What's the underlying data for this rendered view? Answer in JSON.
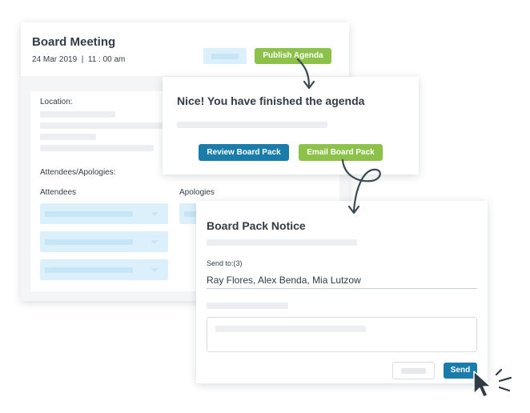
{
  "meeting": {
    "title": "Board Meeting",
    "date": "24 Mar 2019",
    "time": "11 : 00 am",
    "publish_label": "Publish Agenda",
    "location_label": "Location:",
    "attendees_apologies_label": "Attendees/Apologies:",
    "attendees_label": "Attendees",
    "apologies_label": "Apologies"
  },
  "nice": {
    "message": "Nice! You have finished the agenda",
    "review_label": "Review Board Pack",
    "email_label": "Email Board Pack"
  },
  "notice": {
    "title": "Board Pack Notice",
    "send_to_label": "Send to:(3)",
    "recipients": "Ray Flores, Alex Benda, Mia Lutzow",
    "send_label": "Send"
  },
  "colors": {
    "green": "#8dc24a",
    "blue": "#1a7ca8",
    "light_blue": "#dcf0fb",
    "text": "#333c45"
  },
  "icons": [
    "arrow-curve-icon",
    "arrow-loop-icon",
    "mouse-cursor-icon",
    "click-burst-icon"
  ]
}
